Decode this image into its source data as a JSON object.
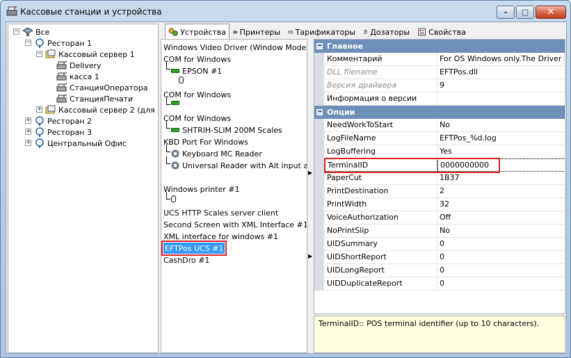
{
  "window": {
    "title": "Кассовые станции и устройства",
    "min_label": "–",
    "max_label": "□",
    "close_label": "✕"
  },
  "tree": [
    {
      "label": "Все",
      "level": 0,
      "expander": "−"
    },
    {
      "label": "Ресторан 1",
      "level": 1,
      "expander": "−"
    },
    {
      "label": "Кассовый сервер 1",
      "level": 2,
      "expander": "−"
    },
    {
      "label": "Delivery",
      "level": 3,
      "expander": ""
    },
    {
      "label": "касса 1",
      "level": 3,
      "expander": ""
    },
    {
      "label": "СтанцияОператора",
      "level": 3,
      "expander": ""
    },
    {
      "label": "СтанцияПечати",
      "level": 3,
      "expander": ""
    },
    {
      "label": "Кассовый сервер 2 (для",
      "level": 2,
      "expander": "+"
    },
    {
      "label": "Ресторан 2",
      "level": 1,
      "expander": "+"
    },
    {
      "label": "Ресторан 3",
      "level": 1,
      "expander": "+"
    },
    {
      "label": "Центральный Офис",
      "level": 1,
      "expander": "+"
    }
  ],
  "tabs": [
    {
      "label": "Устройства",
      "icon": "devices-icon",
      "active": true
    },
    {
      "label": "Принтеры",
      "icon": "printer-icon"
    },
    {
      "label": "Тарификаторы",
      "icon": "tariff-icon"
    },
    {
      "label": "Дозаторы",
      "icon": "dispenser-icon"
    },
    {
      "label": "Свойства",
      "icon": "properties-icon"
    }
  ],
  "devices": {
    "items": [
      "Windows Video Driver (Window Mode)",
      "COM for Windows",
      "EPSON #1",
      "COM for Windows",
      "COM for Windows",
      "SHTRIH-SLIM 200M Scales",
      "KBD Port For Windows",
      "Keyboard MC Reader",
      "Universal Reader with Alt input and r",
      "Windows printer #1",
      "UCS HTTP Scales server client",
      "Second Screen with XML Interface #1",
      "XML interface for windows #1",
      "EFTPos UCS #1",
      "CashDro #1"
    ]
  },
  "props": {
    "cat_main": "Главное",
    "cat_options": "Опции",
    "main_rows": [
      {
        "name": "Комментарий",
        "value": "For OS Windows only.The Driver is de",
        "disabled": false
      },
      {
        "name": "DLL filename",
        "value": "EFTPos.dll",
        "disabled": true
      },
      {
        "name": "Версия драйвера",
        "value": "9",
        "disabled": true
      },
      {
        "name": "Информация о версии",
        "value": "",
        "disabled": false
      }
    ],
    "option_rows": [
      {
        "name": "NeedWorkToStart",
        "value": "No"
      },
      {
        "name": "LogFileName",
        "value": "EFTPos_%d.log"
      },
      {
        "name": "LogBuffering",
        "value": "Yes"
      },
      {
        "name": "TerminalID",
        "value": "0000000000"
      },
      {
        "name": "PaperCut",
        "value": "1B37"
      },
      {
        "name": "PrintDestination",
        "value": "2"
      },
      {
        "name": "PrintWidth",
        "value": "32"
      },
      {
        "name": "VoiceAuthorization",
        "value": "Off"
      },
      {
        "name": "NoPrintSlip",
        "value": "No"
      },
      {
        "name": "UIDSummary",
        "value": "0"
      },
      {
        "name": "UIDShortReport",
        "value": "0"
      },
      {
        "name": "UIDLongReport",
        "value": "0"
      },
      {
        "name": "UIDDuplicateReport",
        "value": "0"
      }
    ]
  },
  "description": "TerminalID:: POS terminal identifier (up to 10 characters).",
  "colors": {
    "category_bg": "#6e8fb8",
    "selection": "#3399ff",
    "highlight_box": "#e02020",
    "description_bg": "#ffffe1"
  }
}
